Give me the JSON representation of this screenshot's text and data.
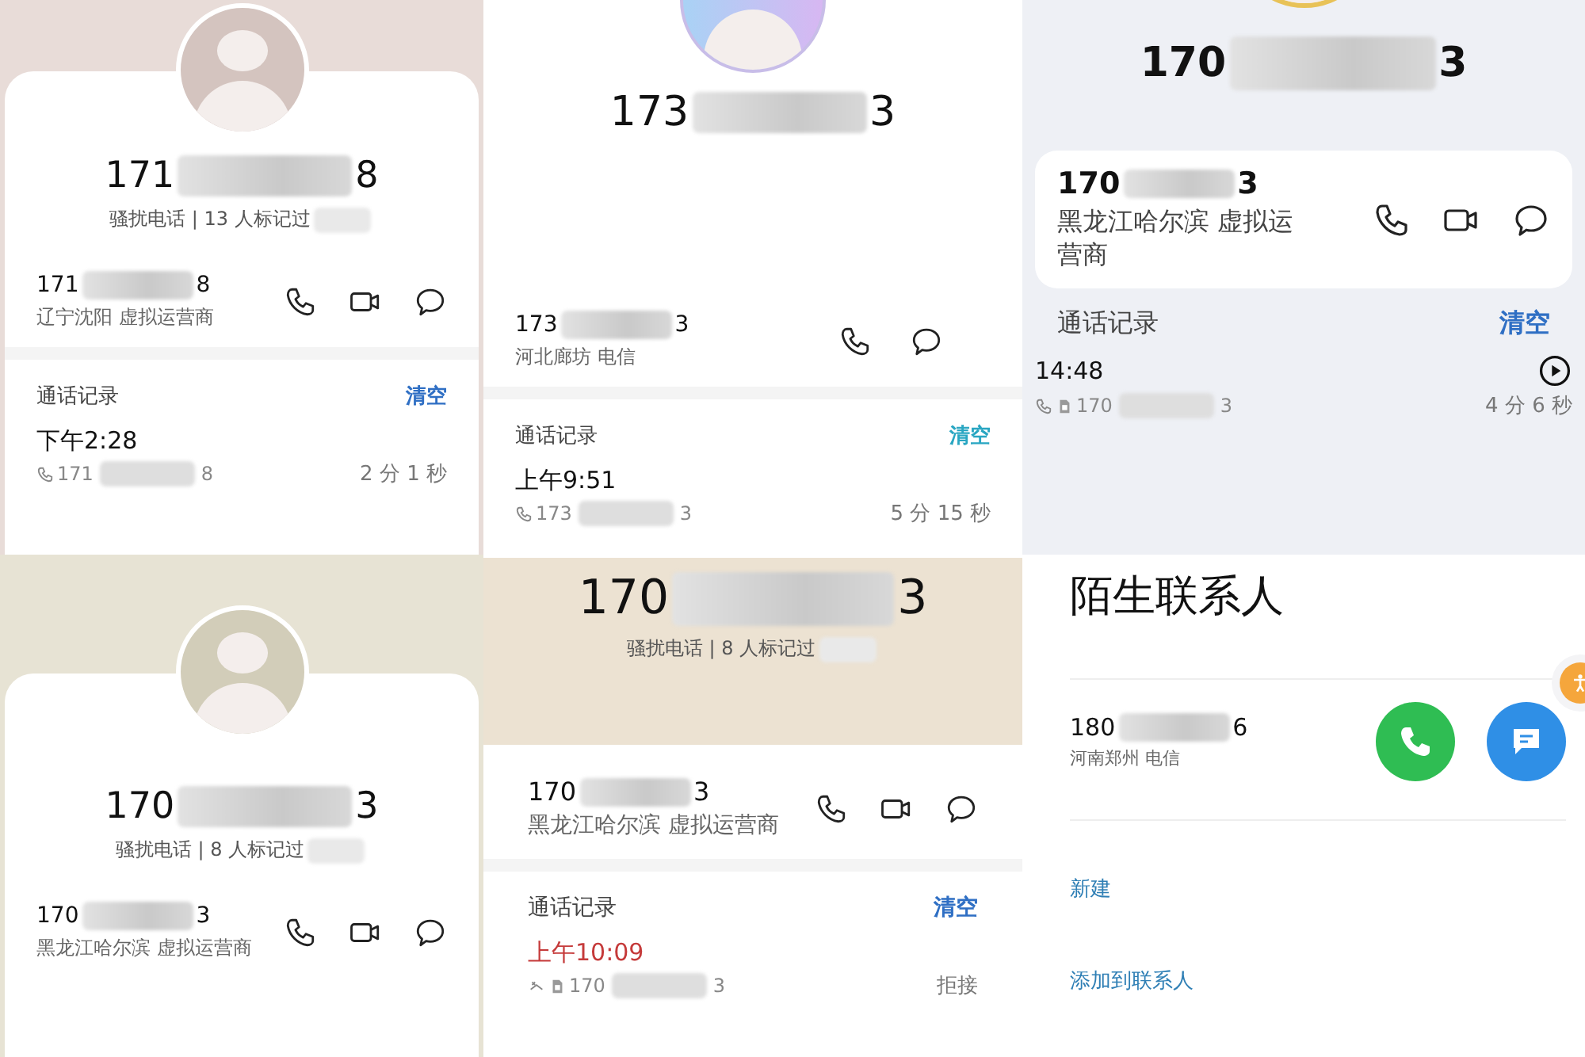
{
  "panels": [
    {
      "kind": "card-header",
      "number": {
        "prefix": "171",
        "suffix": "8"
      },
      "tag": "骚扰电话 | 13 人标记过",
      "contact": {
        "prefix": "171",
        "suffix": "8",
        "location": "辽宁沈阳 虚拟运营商",
        "actions": [
          {
            "kind": "call"
          },
          {
            "kind": "video"
          },
          {
            "kind": "message"
          }
        ]
      },
      "log": {
        "label": "通话记录",
        "clear": "清空",
        "entries": [
          {
            "time": "下午2:28",
            "missed": false,
            "via": [
              {
                "kind": "call"
              }
            ],
            "prefix": "171",
            "suffix": "8",
            "duration": "2 分 1 秒",
            "playable": false
          }
        ]
      }
    },
    {
      "kind": "plain",
      "number": {
        "prefix": "173",
        "suffix": "3"
      },
      "contact": {
        "prefix": "173",
        "suffix": "3",
        "location": "河北廊坊 电信",
        "actions": [
          {
            "kind": "call"
          },
          {
            "kind": "message"
          }
        ]
      },
      "log": {
        "label": "通话记录",
        "clear": "清空",
        "entries": [
          {
            "time": "上午9:51",
            "missed": false,
            "via": [
              {
                "kind": "call"
              }
            ],
            "prefix": "173",
            "suffix": "3",
            "duration": "5 分 15 秒",
            "playable": false
          }
        ]
      }
    },
    {
      "kind": "cards",
      "number": {
        "prefix": "170",
        "suffix": "3"
      },
      "contact": {
        "prefix": "170",
        "suffix": "3",
        "location": "黑龙江哈尔滨 虚拟运营商",
        "actions": [
          {
            "kind": "call"
          },
          {
            "kind": "video"
          },
          {
            "kind": "message"
          }
        ]
      },
      "log": {
        "label": "通话记录",
        "clear": "清空",
        "entries": [
          {
            "time": "14:48",
            "missed": false,
            "via": [
              {
                "kind": "call"
              },
              {
                "kind": "sim"
              }
            ],
            "prefix": "170",
            "suffix": "3",
            "duration": "4 分 6 秒",
            "playable": true
          }
        ]
      }
    },
    {
      "kind": "card-header",
      "number": {
        "prefix": "170",
        "suffix": "3"
      },
      "tag": "骚扰电话 | 8 人标记过",
      "contact": {
        "prefix": "170",
        "suffix": "3",
        "location": "黑龙江哈尔滨 虚拟运营商",
        "actions": [
          {
            "kind": "call"
          },
          {
            "kind": "video"
          },
          {
            "kind": "message"
          }
        ]
      }
    },
    {
      "kind": "banner",
      "number": {
        "prefix": "170",
        "suffix": "3"
      },
      "tag": "骚扰电话 | 8 人标记过",
      "contact": {
        "prefix": "170",
        "suffix": "3",
        "location": "黑龙江哈尔滨 虚拟运营商",
        "actions": [
          {
            "kind": "call"
          },
          {
            "kind": "video"
          },
          {
            "kind": "message"
          }
        ]
      },
      "log": {
        "label": "通话记录",
        "clear": "清空",
        "entries": [
          {
            "time": "上午10:09",
            "missed": true,
            "via": [
              {
                "kind": "missed"
              },
              {
                "kind": "sim"
              }
            ],
            "prefix": "170",
            "suffix": "3",
            "duration": "拒接",
            "playable": false
          }
        ]
      }
    },
    {
      "kind": "stranger",
      "title": "陌生联系人",
      "contact": {
        "prefix": "180",
        "suffix": "6",
        "location": "河南郑州 电信",
        "actions": [
          {
            "kind": "call-round"
          },
          {
            "kind": "message-round"
          }
        ]
      },
      "links": [
        "新建",
        "添加到联系人"
      ]
    }
  ]
}
